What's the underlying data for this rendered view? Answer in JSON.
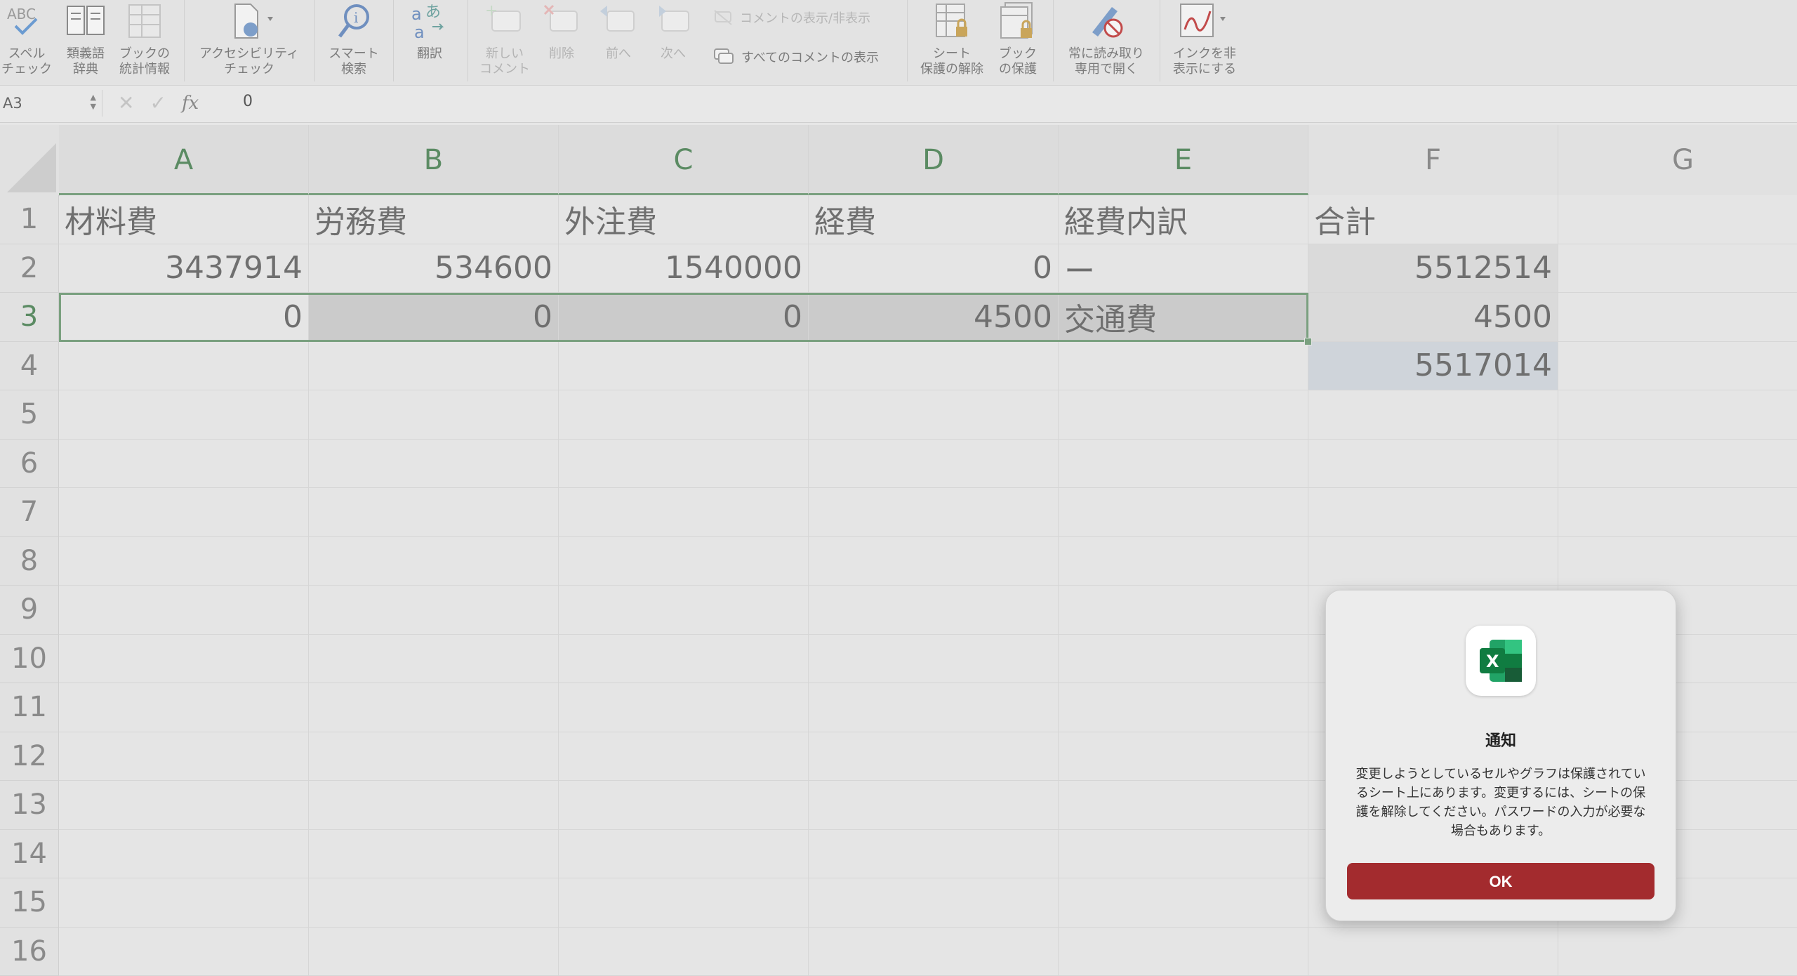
{
  "ribbon": {
    "spelling": "スペル\nチェック",
    "thesaurus": "類義語\n辞典",
    "workbook_stats": "ブックの\n統計情報",
    "accessibility": "アクセシビリティ\nチェック",
    "smart_lookup": "スマート\n検索",
    "translate": "翻訳",
    "new_comment": "新しい\nコメント",
    "delete": "削除",
    "previous": "前へ",
    "next": "次へ",
    "show_hide_comments": "コメントの表示/非表示",
    "show_all_comments": "すべてのコメントの表示",
    "unprotect_sheet": "シート\n保護の解除",
    "protect_workbook": "ブック\nの保護",
    "always_open_readonly": "常に読み取り\n専用で開く",
    "hide_ink": "インクを非\n表示にする"
  },
  "formula_bar": {
    "name_box": "A3",
    "cancel": "✕",
    "enter": "✓",
    "fx": "fx",
    "value": "0"
  },
  "columns": [
    "A",
    "B",
    "C",
    "D",
    "E",
    "F",
    "G"
  ],
  "rows": [
    "1",
    "2",
    "3",
    "4",
    "5",
    "6",
    "7",
    "8",
    "9",
    "10",
    "11",
    "12",
    "13",
    "14",
    "15",
    "16"
  ],
  "cells": {
    "A1": "材料費",
    "B1": "労務費",
    "C1": "外注費",
    "D1": "経費",
    "E1": "経費内訳",
    "F1": "合計",
    "A2": "3437914",
    "B2": "534600",
    "C2": "1540000",
    "D2": "0",
    "E2": "ー",
    "F2": "5512514",
    "A3": "0",
    "B3": "0",
    "C3": "0",
    "D3": "4500",
    "E3": "交通費",
    "F3": "4500",
    "F4": "5517014"
  },
  "dialog": {
    "title": "通知",
    "message": "変更しようとしているセルやグラフは保護されているシート上にあります。変更するには、シートの保護を解除してください。パスワードの入力が必要な場合もあります。",
    "ok_label": "OK",
    "accent_color": "#a32b2e"
  }
}
